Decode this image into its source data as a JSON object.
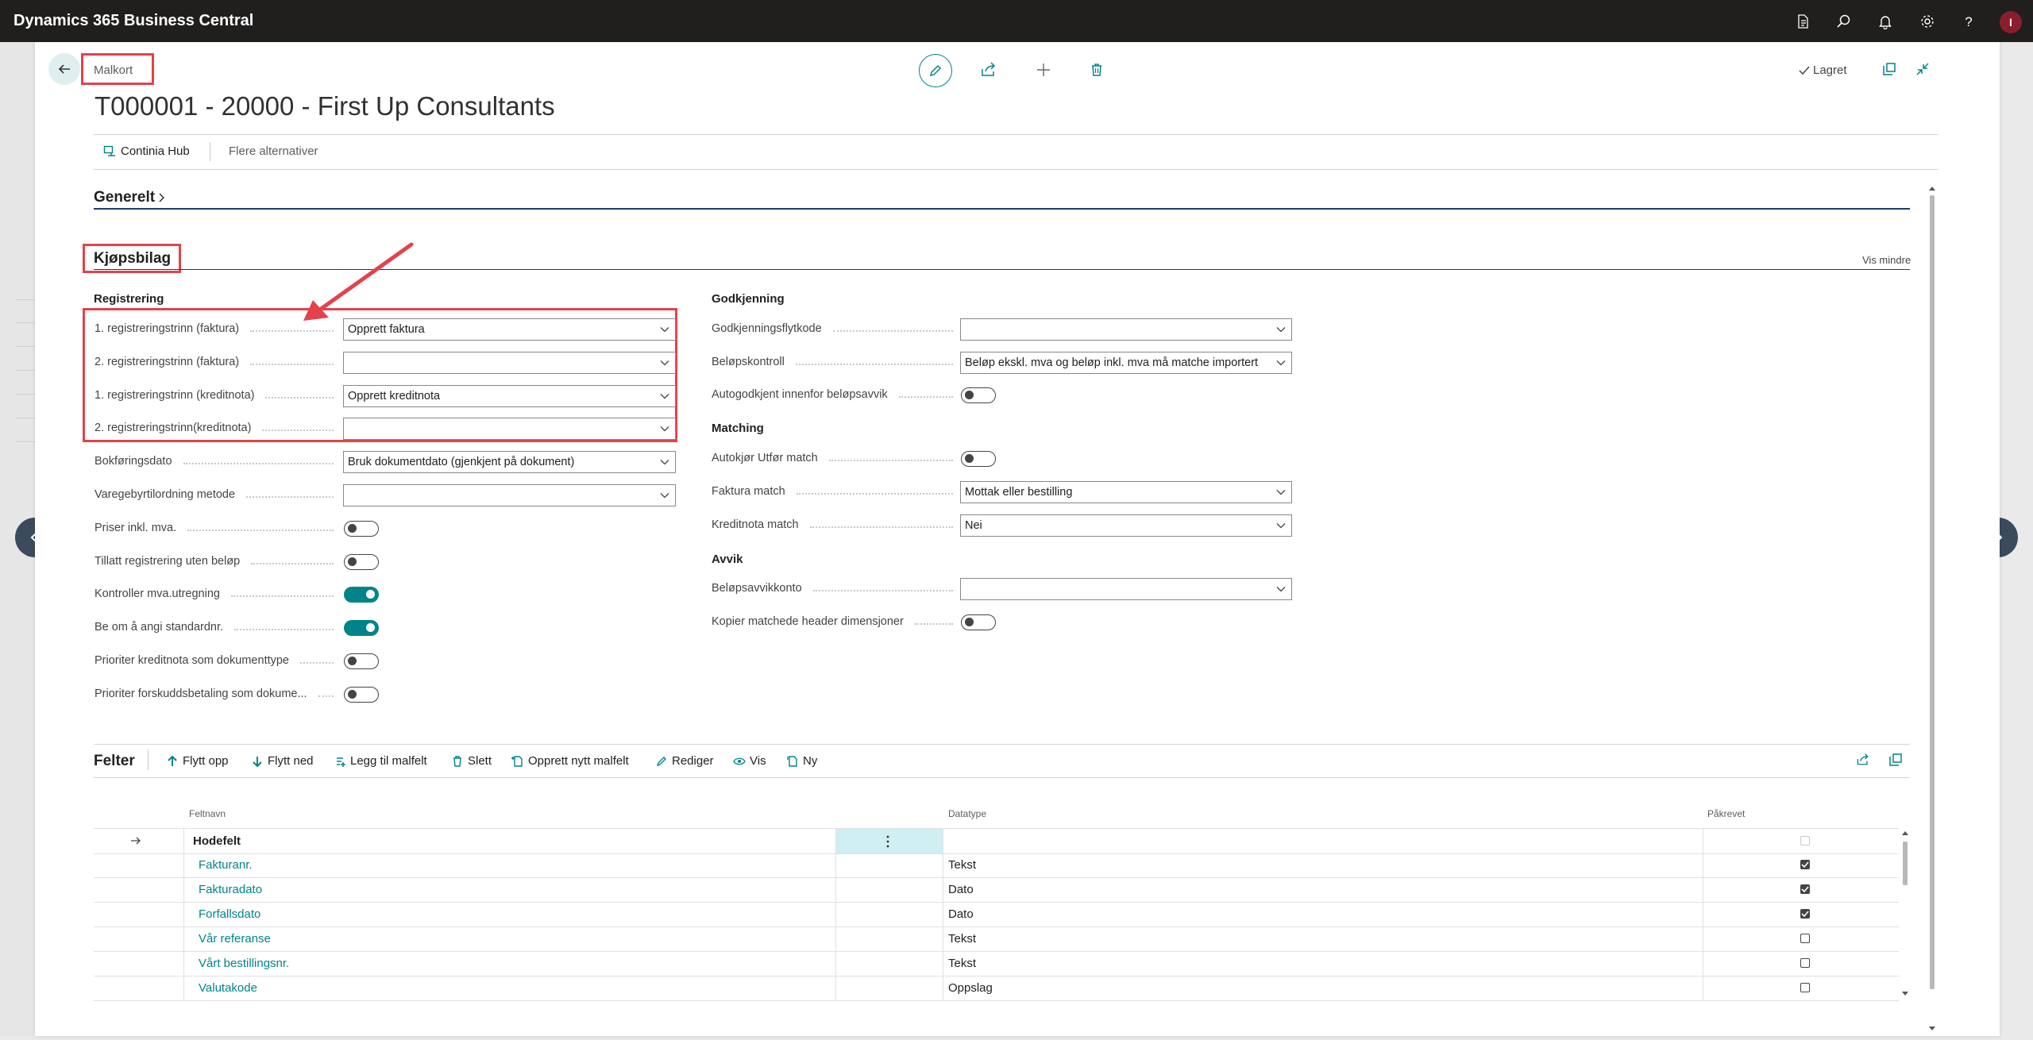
{
  "app": {
    "title": "Dynamics 365 Business Central",
    "avatar_initial": "I"
  },
  "topbar_icons": [
    "report-icon",
    "search-icon",
    "bell-icon",
    "gear-icon",
    "help-icon"
  ],
  "page": {
    "breadcrumb": "Malkort",
    "title": "T000001 - 20000 - First Up Consultants",
    "saved_status": "Lagret"
  },
  "actionbar": {
    "continia_hub": "Continia Hub",
    "more_options": "Flere alternativer"
  },
  "sections": {
    "general": "Generelt",
    "purchase": "Kjøpsbilag",
    "show_less": "Vis mindre"
  },
  "registration": {
    "title": "Registrering",
    "fields": [
      {
        "label": "1. registreringstrinn (faktura)",
        "type": "select",
        "value": "Opprett faktura"
      },
      {
        "label": "2. registreringstrinn (faktura)",
        "type": "select",
        "value": ""
      },
      {
        "label": "1. registreringstrinn (kreditnota)",
        "type": "select",
        "value": "Opprett kreditnota"
      },
      {
        "label": "2. registreringstrinn(kreditnota)",
        "type": "select",
        "value": ""
      },
      {
        "label": "Bokføringsdato",
        "type": "select",
        "value": "Bruk dokumentdato (gjenkjent på dokument)"
      },
      {
        "label": "Varegebyrtilordning metode",
        "type": "select",
        "value": ""
      },
      {
        "label": "Priser inkl. mva.",
        "type": "toggle",
        "on": false
      },
      {
        "label": "Tillatt registrering uten beløp",
        "type": "toggle",
        "on": false
      },
      {
        "label": "Kontroller mva.utregning",
        "type": "toggle",
        "on": true
      },
      {
        "label": "Be om å angi standardnr.",
        "type": "toggle",
        "on": true
      },
      {
        "label": "Prioriter kreditnota som dokumenttype",
        "type": "toggle",
        "on": false
      },
      {
        "label": "Prioriter forskuddsbetaling som dokume...",
        "type": "toggle",
        "on": false
      }
    ]
  },
  "approval": {
    "title": "Godkjenning",
    "fields": [
      {
        "label": "Godkjenningsflytkode",
        "type": "select",
        "value": ""
      },
      {
        "label": "Beløpskontroll",
        "type": "select",
        "value": "Beløp ekskl. mva og beløp inkl. mva må matche importert"
      },
      {
        "label": "Autogodkjent innenfor beløpsavvik",
        "type": "toggle",
        "on": false
      }
    ]
  },
  "matching": {
    "title": "Matching",
    "fields": [
      {
        "label": "Autokjør Utfør match",
        "type": "toggle",
        "on": false
      },
      {
        "label": "Faktura match",
        "type": "select",
        "value": "Mottak eller bestilling"
      },
      {
        "label": "Kreditnota match",
        "type": "select",
        "value": "Nei"
      }
    ]
  },
  "deviation": {
    "title": "Avvik",
    "fields": [
      {
        "label": "Beløpsavvikkonto",
        "type": "select",
        "value": ""
      },
      {
        "label": "Kopier matchede header dimensjoner",
        "type": "toggle",
        "on": false
      }
    ]
  },
  "fields_part": {
    "title": "Felter",
    "actions": [
      "Flytt opp",
      "Flytt ned",
      "Legg til malfelt",
      "Slett",
      "Opprett nytt malfelt",
      "Rediger",
      "Vis",
      "Ny"
    ],
    "columns": {
      "name": "Feltnavn",
      "datatype": "Datatype",
      "required": "Påkrevet"
    },
    "rows": [
      {
        "name": "Hodefelt",
        "datatype": "",
        "required": false,
        "header": true
      },
      {
        "name": "Fakturanr.",
        "datatype": "Tekst",
        "required": true
      },
      {
        "name": "Fakturadato",
        "datatype": "Dato",
        "required": true
      },
      {
        "name": "Forfallsdato",
        "datatype": "Dato",
        "required": true
      },
      {
        "name": "Vår referanse",
        "datatype": "Tekst",
        "required": false
      },
      {
        "name": "Vårt bestillingsnr.",
        "datatype": "Tekst",
        "required": false
      },
      {
        "name": "Valutakode",
        "datatype": "Oppslag",
        "required": false
      }
    ]
  },
  "colors": {
    "accent": "#008489",
    "annotation": "#e3424b",
    "topbar": "#201f1e",
    "section_rule": "#1f3b6b"
  }
}
